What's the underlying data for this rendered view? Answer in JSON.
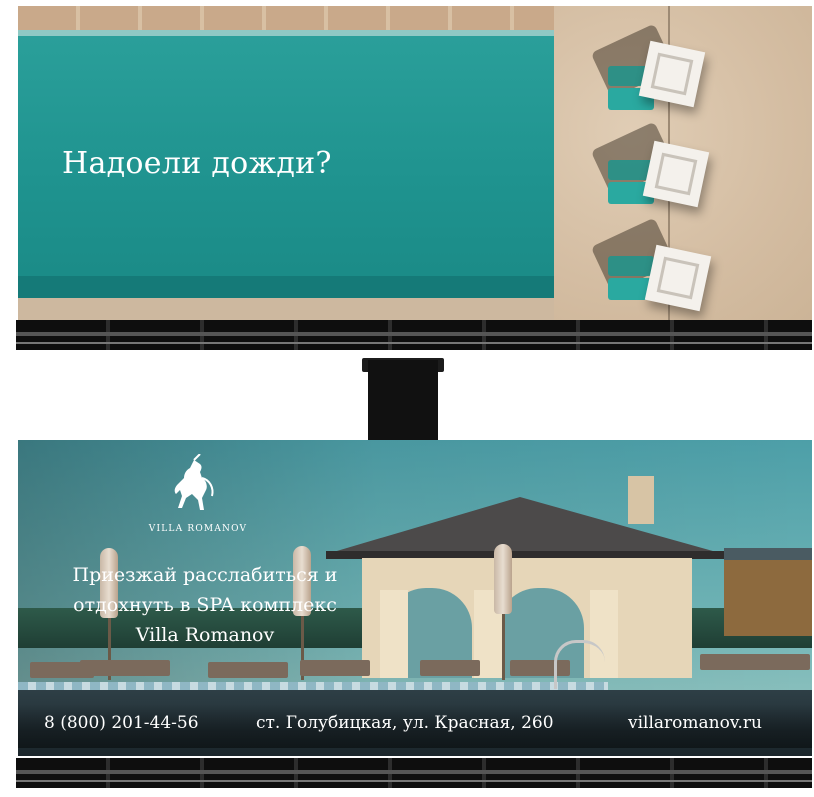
{
  "billboard_top": {
    "headline": "Надоели дожди?"
  },
  "billboard_bottom": {
    "brand_name": "VILLA   ROMANOV",
    "tagline_lines": [
      "Приезжай расслабиться и",
      "отдохнуть в SPA комплекс",
      "Villa Romanov"
    ],
    "phone": "8 (800) 201-44-56",
    "address": "ст. Голубицкая, ул. Красная, 260",
    "website": "villaromanov.ru"
  },
  "colors": {
    "pool": "#1f938f",
    "sky": "#4d9fa8",
    "frame": "#0e0e0e",
    "text": "#ffffff"
  },
  "icons": [
    "unicorn-logo-icon"
  ]
}
